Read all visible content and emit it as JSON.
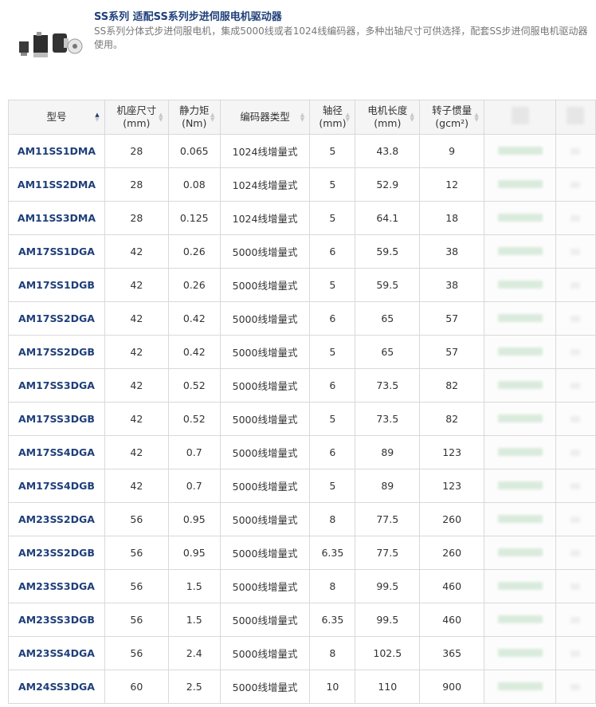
{
  "header": {
    "title": "SS系列 适配SS系列步进伺服电机驱动器",
    "description": "SS系列分体式步进伺服电机，集成5000线或者1024线编码器，多种出轴尺寸可供选择，配套SS步进伺服电机驱动器使用。"
  },
  "table": {
    "columns": [
      {
        "line1": "型号",
        "line2": ""
      },
      {
        "line1": "机座尺寸",
        "line2": "(mm)"
      },
      {
        "line1": "静力矩",
        "line2": "(Nm)"
      },
      {
        "line1": "编码器类型",
        "line2": ""
      },
      {
        "line1": "轴径",
        "line2": "(mm)"
      },
      {
        "line1": "电机长度",
        "line2": "(mm)"
      },
      {
        "line1": "转子惯量",
        "line2": "(gcm²)"
      }
    ],
    "rows": [
      {
        "model": "AM11SS1DMA",
        "frame": "28",
        "torque": "0.065",
        "encoder": "1024线增量式",
        "shaft": "5",
        "length": "43.8",
        "inertia": "9"
      },
      {
        "model": "AM11SS2DMA",
        "frame": "28",
        "torque": "0.08",
        "encoder": "1024线增量式",
        "shaft": "5",
        "length": "52.9",
        "inertia": "12"
      },
      {
        "model": "AM11SS3DMA",
        "frame": "28",
        "torque": "0.125",
        "encoder": "1024线增量式",
        "shaft": "5",
        "length": "64.1",
        "inertia": "18"
      },
      {
        "model": "AM17SS1DGA",
        "frame": "42",
        "torque": "0.26",
        "encoder": "5000线增量式",
        "shaft": "6",
        "length": "59.5",
        "inertia": "38"
      },
      {
        "model": "AM17SS1DGB",
        "frame": "42",
        "torque": "0.26",
        "encoder": "5000线增量式",
        "shaft": "5",
        "length": "59.5",
        "inertia": "38"
      },
      {
        "model": "AM17SS2DGA",
        "frame": "42",
        "torque": "0.42",
        "encoder": "5000线增量式",
        "shaft": "6",
        "length": "65",
        "inertia": "57"
      },
      {
        "model": "AM17SS2DGB",
        "frame": "42",
        "torque": "0.42",
        "encoder": "5000线增量式",
        "shaft": "5",
        "length": "65",
        "inertia": "57"
      },
      {
        "model": "AM17SS3DGA",
        "frame": "42",
        "torque": "0.52",
        "encoder": "5000线增量式",
        "shaft": "6",
        "length": "73.5",
        "inertia": "82"
      },
      {
        "model": "AM17SS3DGB",
        "frame": "42",
        "torque": "0.52",
        "encoder": "5000线增量式",
        "shaft": "5",
        "length": "73.5",
        "inertia": "82"
      },
      {
        "model": "AM17SS4DGA",
        "frame": "42",
        "torque": "0.7",
        "encoder": "5000线增量式",
        "shaft": "6",
        "length": "89",
        "inertia": "123"
      },
      {
        "model": "AM17SS4DGB",
        "frame": "42",
        "torque": "0.7",
        "encoder": "5000线增量式",
        "shaft": "5",
        "length": "89",
        "inertia": "123"
      },
      {
        "model": "AM23SS2DGA",
        "frame": "56",
        "torque": "0.95",
        "encoder": "5000线增量式",
        "shaft": "8",
        "length": "77.5",
        "inertia": "260"
      },
      {
        "model": "AM23SS2DGB",
        "frame": "56",
        "torque": "0.95",
        "encoder": "5000线增量式",
        "shaft": "6.35",
        "length": "77.5",
        "inertia": "260"
      },
      {
        "model": "AM23SS3DGA",
        "frame": "56",
        "torque": "1.5",
        "encoder": "5000线增量式",
        "shaft": "8",
        "length": "99.5",
        "inertia": "460"
      },
      {
        "model": "AM23SS3DGB",
        "frame": "56",
        "torque": "1.5",
        "encoder": "5000线增量式",
        "shaft": "6.35",
        "length": "99.5",
        "inertia": "460"
      },
      {
        "model": "AM23SS4DGA",
        "frame": "56",
        "torque": "2.4",
        "encoder": "5000线增量式",
        "shaft": "8",
        "length": "102.5",
        "inertia": "365"
      },
      {
        "model": "AM24SS3DGA",
        "frame": "60",
        "torque": "2.5",
        "encoder": "5000线增量式",
        "shaft": "10",
        "length": "110",
        "inertia": "900"
      }
    ]
  },
  "colors": {
    "accent": "#1f3f7a",
    "border": "#d9d9d9",
    "header_bg": "#f5f5f5",
    "blur_green": "#d9ebdc"
  }
}
